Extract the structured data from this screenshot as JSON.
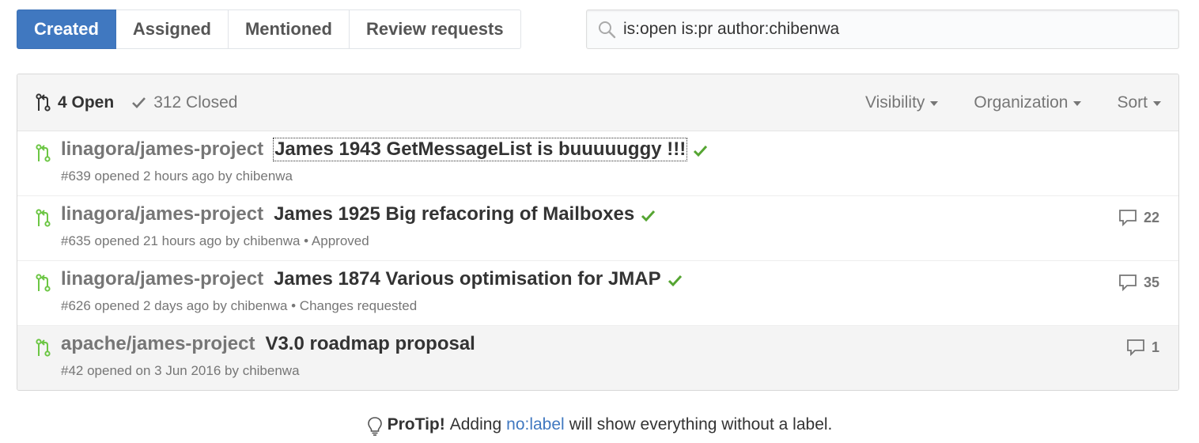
{
  "tabs": [
    {
      "label": "Created",
      "selected": true
    },
    {
      "label": "Assigned",
      "selected": false
    },
    {
      "label": "Mentioned",
      "selected": false
    },
    {
      "label": "Review requests",
      "selected": false
    }
  ],
  "search": {
    "value": "is:open is:pr author:chibenwa",
    "icon": "search-icon"
  },
  "states": {
    "open_label": "4 Open",
    "closed_label": "312 Closed"
  },
  "filters": {
    "visibility": "Visibility",
    "organization": "Organization",
    "sort": "Sort"
  },
  "colors": {
    "accent": "#4078c0",
    "open_green": "#6cc644",
    "check_green": "#55a532",
    "muted": "#767676"
  },
  "pull_requests": [
    {
      "repo": "linagora/james-project",
      "title": "James 1943 GetMessageList is buuuuuggy !!!",
      "meta": "#639 opened 2 hours ago by chibenwa",
      "comments": "",
      "check": true
    },
    {
      "repo": "linagora/james-project",
      "title": "James 1925 Big refacoring of Mailboxes",
      "meta": "#635 opened 21 hours ago by chibenwa • Approved",
      "comments": "22",
      "check": true
    },
    {
      "repo": "linagora/james-project",
      "title": "James 1874 Various optimisation for JMAP",
      "meta": "#626 opened 2 days ago by chibenwa • Changes requested",
      "comments": "35",
      "check": true
    },
    {
      "repo": "apache/james-project",
      "title": "V3.0 roadmap proposal",
      "meta": "#42 opened on 3 Jun 2016 by chibenwa",
      "comments": "1",
      "check": false
    }
  ],
  "protip": {
    "label": "ProTip!",
    "before": "Adding",
    "link": "no:label",
    "after": "will show everything without a label."
  }
}
